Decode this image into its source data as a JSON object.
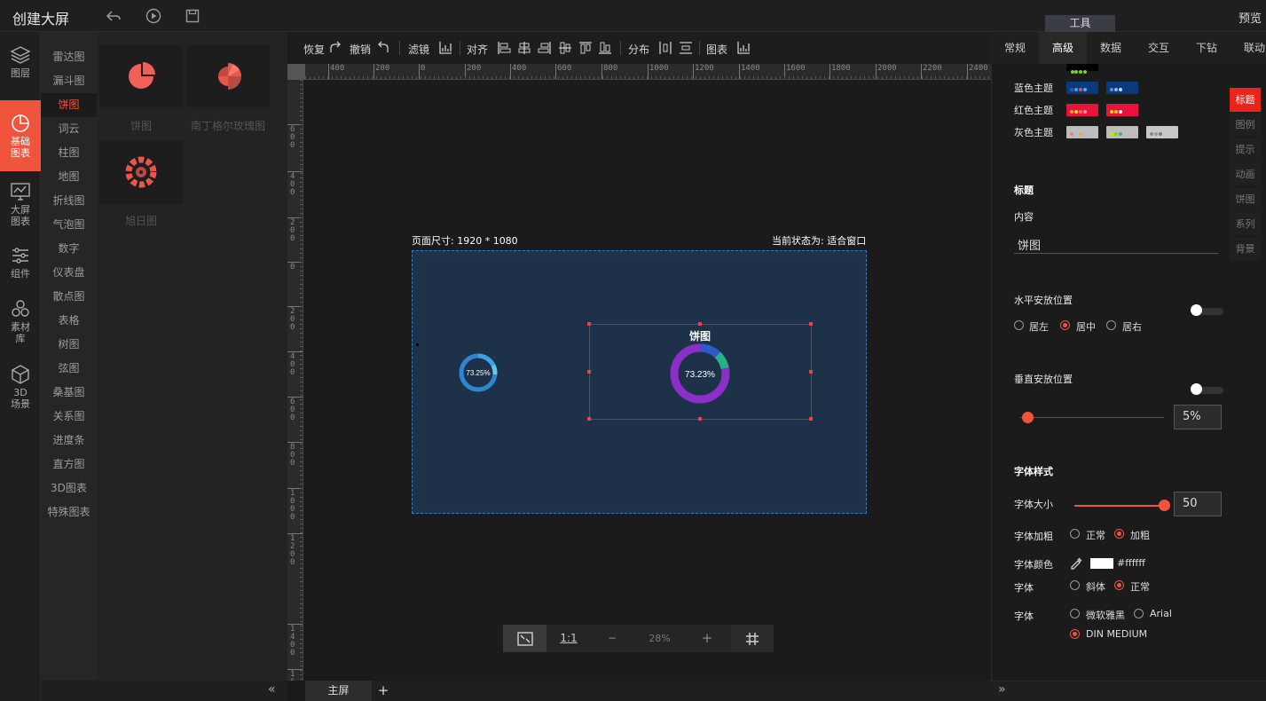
{
  "app": {
    "title": "创建大屏",
    "preview": "预览",
    "tools_tab": "工具"
  },
  "iconbar": [
    {
      "icon": "layers-icon",
      "label1": "图层",
      "label2": ""
    },
    {
      "icon": "pie-chart-icon",
      "label1": "基础",
      "label2": "图表",
      "active": true
    },
    {
      "icon": "monitor-chart-icon",
      "label1": "大屏",
      "label2": "图表"
    },
    {
      "icon": "sliders-icon",
      "label1": "组件",
      "label2": ""
    },
    {
      "icon": "hexagons-icon",
      "label1": "素材",
      "label2": "库"
    },
    {
      "icon": "cube-icon",
      "label1": "3D",
      "label2": "场景"
    }
  ],
  "categories": [
    "雷达图",
    "漏斗图",
    "饼图",
    "词云",
    "柱图",
    "地图",
    "折线图",
    "气泡图",
    "数字",
    "仪表盘",
    "散点图",
    "表格",
    "树图",
    "弦图",
    "桑基图",
    "关系图",
    "进度条",
    "直方图",
    "3D图表",
    "特殊图表"
  ],
  "active_category": "饼图",
  "thumbs": [
    {
      "label": "饼图",
      "icon": "pie-icon"
    },
    {
      "label": "南丁格尔玫瑰图",
      "icon": "rose-icon"
    },
    {
      "label": "旭日图",
      "icon": "sunburst-icon"
    }
  ],
  "toolbar": {
    "redo": "恢复",
    "undo": "撤销",
    "filter": "滤镜",
    "align": "对齐",
    "distribute": "分布",
    "chart": "图表"
  },
  "hruler_labels": [
    "400",
    "200",
    "0",
    "200",
    "400",
    "600",
    "800",
    "1000",
    "1200",
    "1400",
    "1600",
    "1800",
    "2000",
    "2200",
    "2400"
  ],
  "vruler_labels": [
    "600",
    "400",
    "200",
    "0",
    "200",
    "400",
    "600",
    "800",
    "1000",
    "1200",
    "1400",
    "1600"
  ],
  "canvas": {
    "page_size": "页面尺寸: 1920 * 1080",
    "status": "当前状态为: 适合窗口",
    "widget_title": "饼图",
    "small_pie_value": "73.25%",
    "big_pie_value": "73.23%"
  },
  "zoom": {
    "value": "28%",
    "ratio": "1:1",
    "minus": "−",
    "plus": "+"
  },
  "bottom_tabs": {
    "main": "主屏",
    "add": "+"
  },
  "right_tabs": [
    "常规",
    "高级",
    "数据",
    "交互",
    "下钻",
    "联动"
  ],
  "active_right_tab": "高级",
  "side_tabs": [
    "标题",
    "图例",
    "提示",
    "动画",
    "饼图",
    "系列",
    "背景"
  ],
  "themes": [
    {
      "label": "蓝色主题",
      "swatches": [
        [
          "#0a3a7a",
          "#2a5ea8",
          "#36a3f7",
          "#e84a5f",
          "#4ab0f0"
        ],
        [
          "#0a3a7a",
          "#5b8de0",
          "#8ab4f8",
          "#c0d4f7"
        ]
      ]
    },
    {
      "label": "红色主题",
      "swatches": [
        [
          "#e8123a",
          "#f5a623",
          "#f8e71c",
          "#ff6b6b",
          "#ff9a9a"
        ],
        [
          "#e8123a",
          "#ffdd00",
          "#ffc107",
          "#fff"
        ]
      ]
    },
    {
      "label": "灰色主题",
      "swatches": [
        [
          "#bdbdbd",
          "#f08080",
          "#87ceeb",
          "#f5a623",
          "#bbbbbb"
        ],
        [
          "#bdbdbd",
          "#dde000",
          "#7ed321",
          "#3cb371"
        ],
        [
          "#c8c8c8",
          "#888",
          "#999",
          "#777"
        ]
      ]
    }
  ],
  "title_section": {
    "heading": "标题",
    "content_label": "内容",
    "content_value": "饼图"
  },
  "hpos": {
    "label": "水平安放位置",
    "options": [
      "居左",
      "居中",
      "居右"
    ],
    "selected": "居中"
  },
  "vpos": {
    "label": "垂直安放位置",
    "value": "5%",
    "fraction": 0.05
  },
  "font": {
    "heading": "字体样式",
    "size_label": "字体大小",
    "size_value": "50",
    "size_fraction": 1.0,
    "weight_label": "字体加粗",
    "weight_options": [
      "正常",
      "加粗"
    ],
    "weight_selected": "加粗",
    "color_label": "字体颜色",
    "color_value": "#ffffff",
    "style_label": "字体",
    "style_options": [
      "斜体",
      "正常"
    ],
    "style_selected": "正常",
    "family_label": "字体",
    "family_options": [
      "微软雅黑",
      "Arial",
      "DIN MEDIUM"
    ],
    "family_selected": "DIN MEDIUM"
  },
  "colors": {
    "accent": "#f0543d",
    "screen_bg": "#1d3249",
    "panel_bg": "#1b1b1c"
  }
}
